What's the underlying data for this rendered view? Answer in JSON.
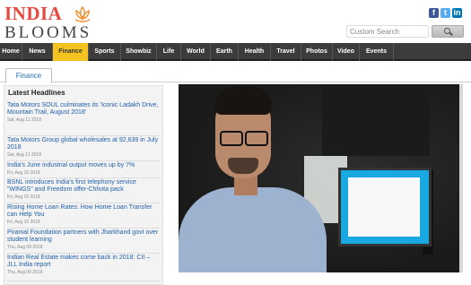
{
  "brand": {
    "line1": "INDIA",
    "line2": "BLOOMS",
    "accent": "#e8483f"
  },
  "social": {
    "facebook": "f",
    "twitter": "t",
    "linkedin": "in"
  },
  "search": {
    "placeholder": "Custom Search",
    "button_icon": "search-icon"
  },
  "nav": {
    "items": [
      "Home",
      "News",
      "Finance",
      "Sports",
      "Showbiz",
      "Life",
      "World",
      "Earth",
      "Health",
      "Travel",
      "Photos",
      "Video",
      "Events"
    ],
    "active": "Finance",
    "active_color": "#f3c41f"
  },
  "tabs": {
    "current": "Finance"
  },
  "sidebar": {
    "title": "Latest Headlines",
    "headlines": [
      {
        "title": "Tata Motors SOUL culminates its 'Iconic Ladakh Drive, Mountain Trail, August 2018'",
        "date": "Sat, Aug 11 2018"
      },
      {
        "title": "Tata Motors Group global wholesales at 92,639 in July 2018",
        "date": "Sat, Aug 11 2018"
      },
      {
        "title": "India's June industrial output moves up by 7%",
        "date": "Fri, Aug 10 2018"
      },
      {
        "title": "BSNL introduces India's first telephony service \"WINGS\" and Freedom offer-Chhota pack",
        "date": "Fri, Aug 10 2018"
      },
      {
        "title": "Rising Home Loan Rates: How Home Loan Transfer can Help You",
        "date": "Fri, Aug 10 2018"
      },
      {
        "title": "Piramal Foundation partners with Jharkhand govt over student learning",
        "date": "Thu, Aug 09 2018"
      },
      {
        "title": "Indian Real Estate makes come back in 2018: CII – JLL India report",
        "date": "Thu, Aug 09 2018"
      }
    ]
  },
  "media": {
    "kind": "video-frame"
  }
}
